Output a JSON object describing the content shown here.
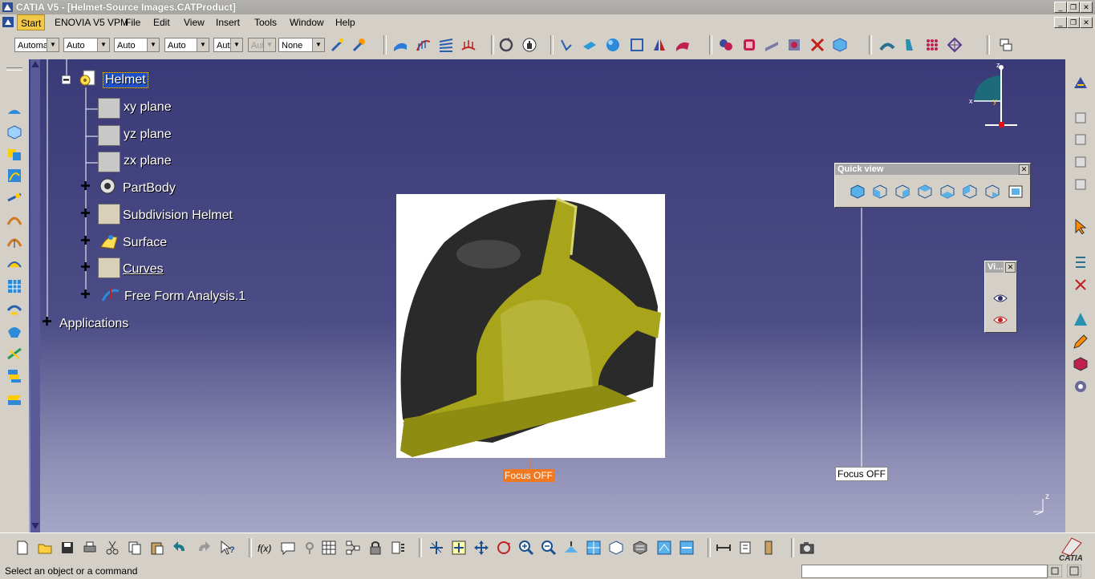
{
  "window": {
    "title": "CATIA V5 - [Helmet-Source Images.CATProduct]"
  },
  "menu": {
    "items": [
      "Start",
      "ENOVIA V5 VPM",
      "File",
      "Edit",
      "View",
      "Insert",
      "Tools",
      "Window",
      "Help"
    ]
  },
  "toolbar": {
    "combos": [
      "Automa",
      "Auto",
      "Auto",
      "Auto",
      "Aut",
      "Aut",
      "None"
    ]
  },
  "tree": {
    "root_label": "Helmet",
    "items": [
      {
        "label": "xy plane"
      },
      {
        "label": "yz plane"
      },
      {
        "label": "zx plane"
      },
      {
        "label": "PartBody"
      },
      {
        "label": "Subdivision Helmet"
      },
      {
        "label": "Surface"
      },
      {
        "label": "Curves"
      },
      {
        "label": "Free Form Analysis.1"
      }
    ],
    "applications_label": "Applications"
  },
  "quickview": {
    "title": "Quick view"
  },
  "vi_panel": {
    "title": "Vi..."
  },
  "focus": {
    "left_label": "Focus OFF",
    "right_label": "Focus OFF"
  },
  "compass": {
    "z": "z",
    "x": "x",
    "y": "y"
  },
  "axis_corner": {
    "label": "z"
  },
  "status": {
    "text": "Select an object or a command"
  },
  "colors": {
    "viewport_top": "#3a3a78",
    "viewport_bottom": "#a6a6c6",
    "helmet_yellow": "#a9a51a",
    "selection": "#2050c8",
    "focus_orange": "#f07820"
  }
}
